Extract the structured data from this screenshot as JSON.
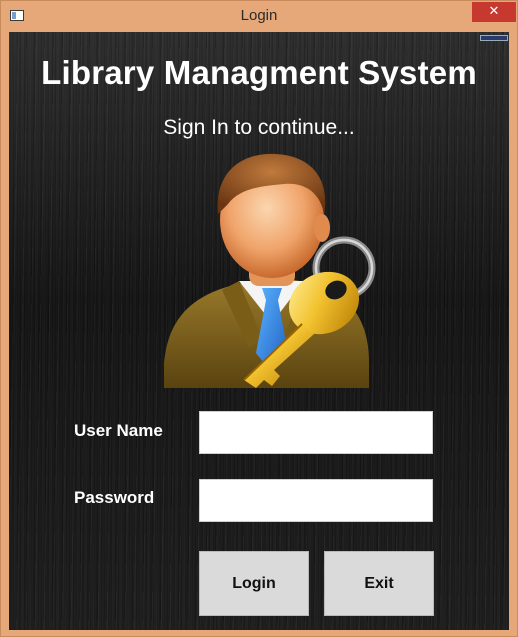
{
  "window": {
    "title": "Login",
    "close_glyph": "✕",
    "icon": "window-app-icon",
    "colors": {
      "frame": "#e6a878",
      "close_button": "#c7392f",
      "background": "#161616",
      "input_background": "#ffffff",
      "button_background": "#dadada"
    }
  },
  "header": {
    "title": "Library Managment System",
    "subtitle": "Sign In to continue..."
  },
  "illustration": {
    "icon": "user-key-icon"
  },
  "form": {
    "username_label": "User Name",
    "username_value": "",
    "password_label": "Password",
    "password_value": ""
  },
  "buttons": {
    "login_label": "Login",
    "exit_label": "Exit"
  }
}
